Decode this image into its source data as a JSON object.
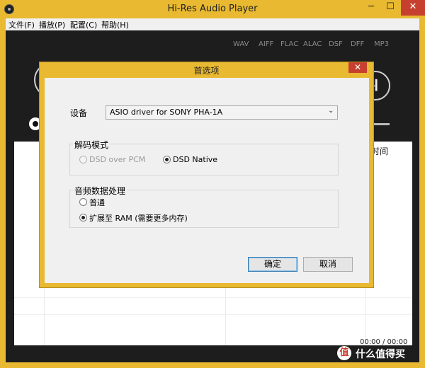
{
  "window": {
    "title": "Hi-Res Audio Player",
    "close_glyph": "✕",
    "min_glyph": "─",
    "max_glyph": "☐"
  },
  "menu": [
    "文件(F)",
    "播放(P)",
    "配置(C)",
    "帮助(H)"
  ],
  "formats": [
    "WAV",
    "AIFF",
    "FLAC",
    "ALAC",
    "DSF",
    "DFF",
    "MP3"
  ],
  "playlist": {
    "column_time": "时间",
    "time_readout": "00:00 / 00:00"
  },
  "watermark": {
    "icon": "值",
    "text": "什么值得买"
  },
  "dialog": {
    "title": "首选项",
    "close_glyph": "✕",
    "device_label": "设备",
    "device_value": "ASIO driver for SONY PHA-1A",
    "decode_group": "解码模式",
    "decode_options": [
      {
        "label": "DSD over PCM",
        "checked": false,
        "disabled": true
      },
      {
        "label": "DSD Native",
        "checked": true,
        "disabled": false
      }
    ],
    "audio_group": "音频数据处理",
    "audio_options": [
      {
        "label": "普通",
        "checked": false
      },
      {
        "label": "扩展至 RAM (需要更多内存)",
        "checked": true
      }
    ],
    "ok": "确定",
    "cancel": "取消"
  },
  "colors": {
    "frame": "#e8b931",
    "client": "#1d1d1d",
    "close": "#c7402f"
  }
}
